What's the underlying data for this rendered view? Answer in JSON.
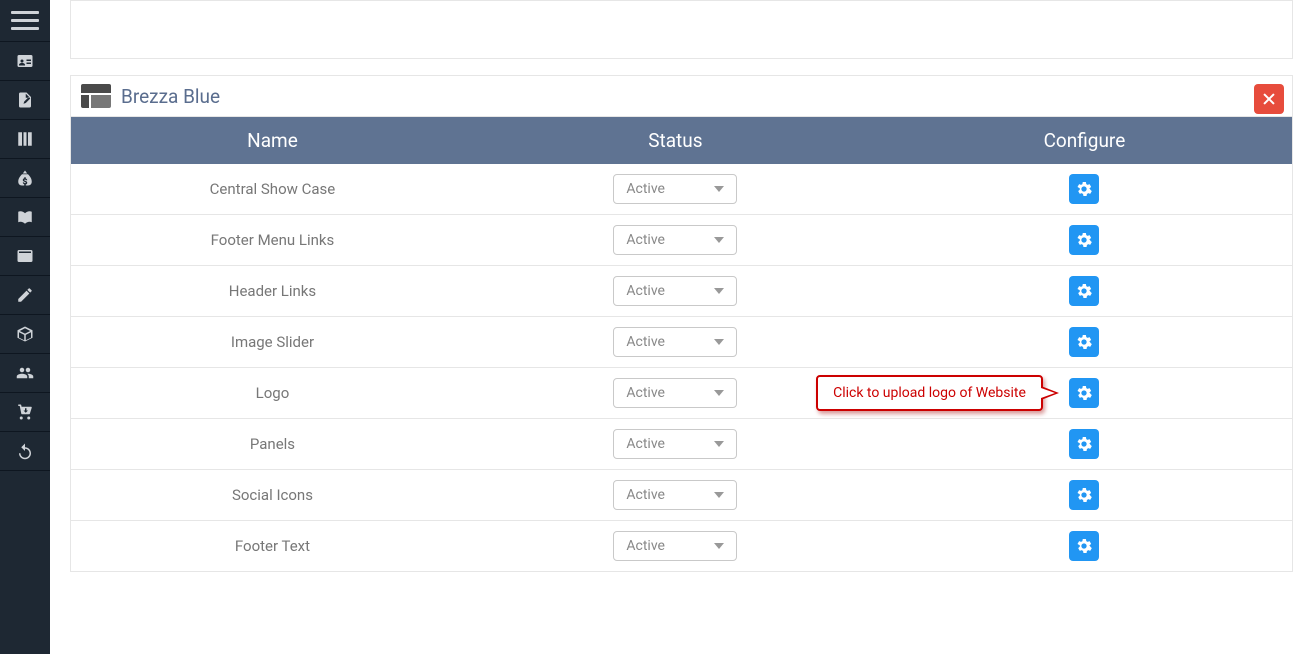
{
  "sidebar": {
    "items": [
      {
        "name": "hamburger"
      },
      {
        "name": "id-card"
      },
      {
        "name": "edit-doc"
      },
      {
        "name": "columns"
      },
      {
        "name": "money-bag"
      },
      {
        "name": "book"
      },
      {
        "name": "card"
      },
      {
        "name": "edit-flat"
      },
      {
        "name": "box"
      },
      {
        "name": "users"
      },
      {
        "name": "cart-down"
      },
      {
        "name": "undo"
      }
    ]
  },
  "panel": {
    "title": "Brezza Blue"
  },
  "table": {
    "headers": {
      "name": "Name",
      "status": "Status",
      "configure": "Configure"
    },
    "rows": [
      {
        "name": "Central Show Case",
        "status": "Active"
      },
      {
        "name": "Footer Menu Links",
        "status": "Active"
      },
      {
        "name": "Header Links",
        "status": "Active"
      },
      {
        "name": "Image Slider",
        "status": "Active"
      },
      {
        "name": "Logo",
        "status": "Active",
        "callout": "Click to upload logo of Website"
      },
      {
        "name": "Panels",
        "status": "Active"
      },
      {
        "name": "Social Icons",
        "status": "Active"
      },
      {
        "name": "Footer Text",
        "status": "Active"
      }
    ]
  }
}
